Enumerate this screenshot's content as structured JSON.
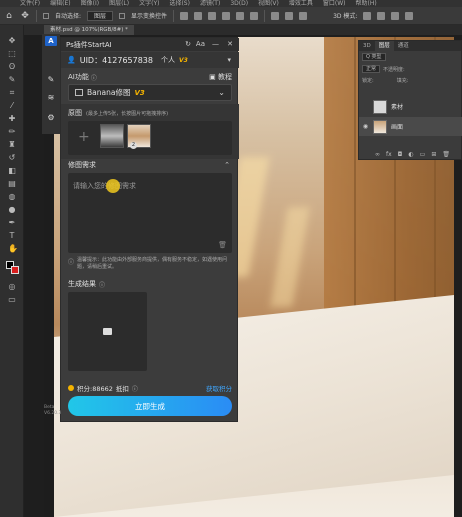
{
  "menubar": [
    "文件(F)",
    "编辑(E)",
    "图像(I)",
    "图层(L)",
    "文字(Y)",
    "选择(S)",
    "滤镜(T)",
    "3D(D)",
    "视图(V)",
    "增效工具",
    "窗口(W)",
    "帮助(H)"
  ],
  "options": {
    "auto_select_label": "自动选择:",
    "auto_select_value": "图层",
    "transform_label": "显示变换控件",
    "mode_3d": "3D 模式:"
  },
  "document_tab": "素材.psd @ 107%(RGB/8#) *",
  "layers_panel": {
    "tabs": [
      "3D",
      "图层",
      "通道"
    ],
    "kind_filter": "Q 类型",
    "blend_mode": "正常",
    "opacity_label": "不透明度:",
    "lock_label": "锁定:",
    "fill_label": "填充:",
    "layers": [
      {
        "name": "素材",
        "visible": false
      },
      {
        "name": "画面",
        "visible": true
      }
    ]
  },
  "plugin": {
    "title": "Ps插件StartAI",
    "header_icons": [
      "refresh-icon",
      "font-size-icon",
      "collapse-icon",
      "close-icon"
    ],
    "uid": "UID：4127657838",
    "account_type": "个人",
    "version_tag": "V3",
    "ai_function_label": "AI功能",
    "tutorial_label": "教程",
    "selected_function": "Banana修图",
    "selected_version": "V3",
    "source_title": "原图",
    "source_hint": "(最多上传5张，长按图片可拖拽排序)",
    "source_badge": "2",
    "request_title": "修图需求",
    "request_placeholder": "请输入您的修图需求",
    "notice": "温馨提示：此功能由外部服务商提供，偶有服务不稳定，如遇使用问题，请稍后重试。",
    "result_title": "生成结果",
    "points_label": "积分:88662",
    "points_suffix": "抵扣",
    "get_points": "获取积分",
    "generate_button": "立即生成"
  },
  "side_label": [
    "Beta",
    "V6.20.3"
  ],
  "colors": {
    "accent_blue": "#2a8cf5",
    "accent_cyan": "#21c7e8",
    "version_gold": "#f5b400",
    "bg_color": "#d81e1e",
    "fg_color": "#000000"
  }
}
